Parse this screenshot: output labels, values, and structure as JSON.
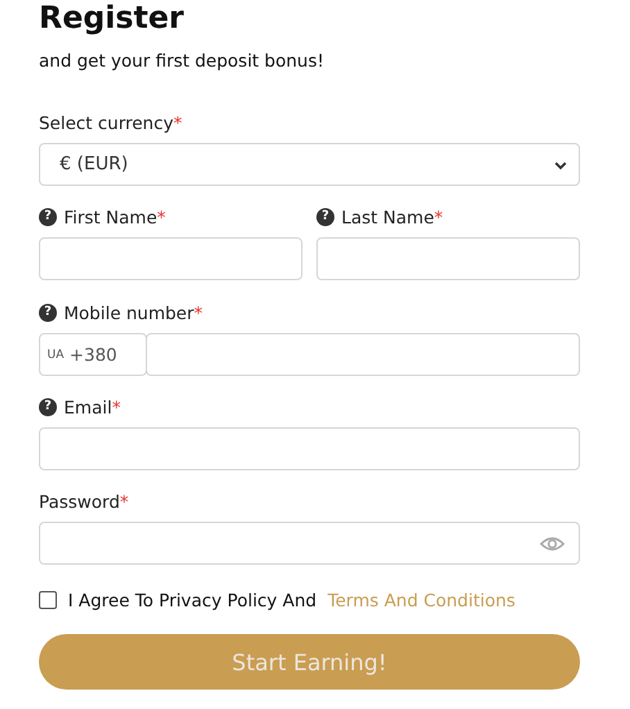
{
  "title": "Register",
  "subtitle": "and get your first deposit bonus!",
  "currency": {
    "label": "Select currency",
    "required_mark": "*",
    "value": "€ (EUR)"
  },
  "name_fields": [
    {
      "help": "?",
      "label": "First Name",
      "required_mark": "*"
    },
    {
      "help": "?",
      "label": "Last Name",
      "required_mark": "*"
    }
  ],
  "phone": {
    "help": "?",
    "label": "Mobile number",
    "required_mark": "*",
    "country": "UA",
    "code": "+380"
  },
  "email": {
    "help": "?",
    "label": "Email",
    "required_mark": "*"
  },
  "password": {
    "label": "Password",
    "required_mark": "*"
  },
  "agree": {
    "checked": false,
    "text": "I Agree To Privacy Policy And",
    "link": "Terms And Conditions"
  },
  "submit": "Start Earning!"
}
